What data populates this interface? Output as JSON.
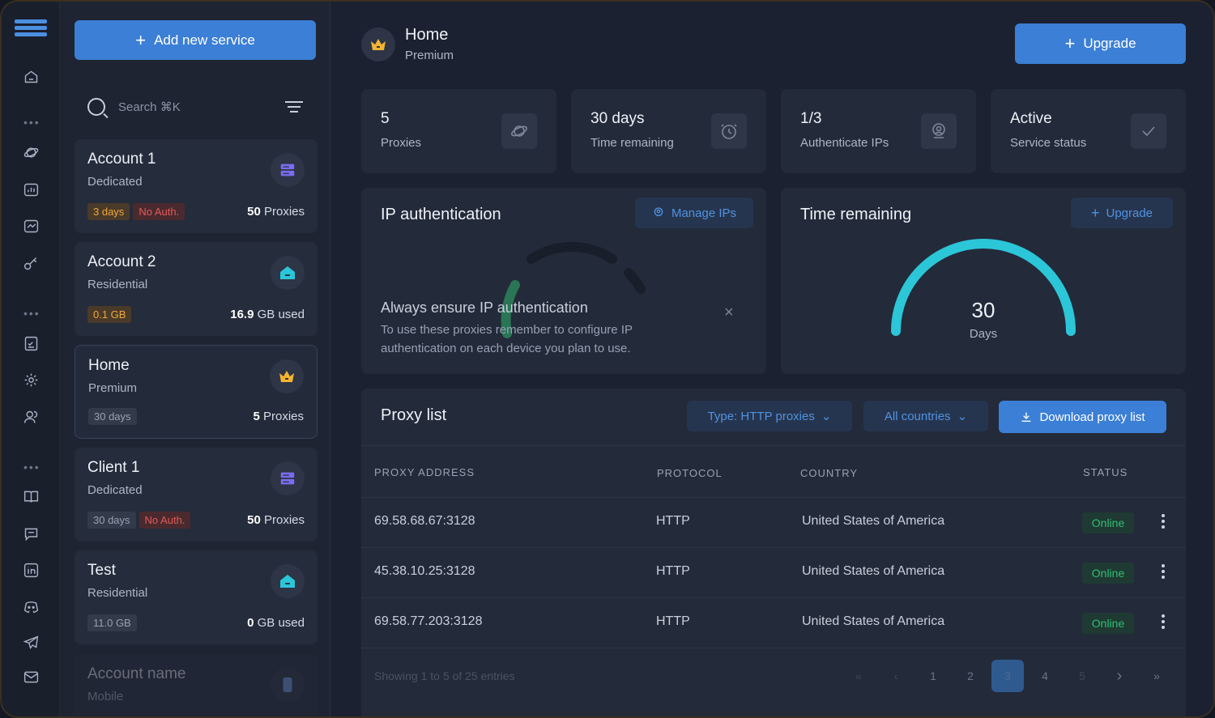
{
  "sidebar": {
    "logo": "server-logo",
    "icons": [
      "home-icon",
      "planet-icon",
      "chart-icon",
      "gauge-icon",
      "key-icon",
      "checklist-icon",
      "gear-icon",
      "users-icon",
      "book-icon",
      "chat-icon",
      "linkedin-icon",
      "discord-icon",
      "telegram-icon",
      "mail-icon"
    ],
    "dots": "•••"
  },
  "services": {
    "add_label": "Add new service",
    "search_placeholder": "Search ⌘K",
    "cards": [
      {
        "title": "Account 1",
        "subtitle": "Dedicated",
        "tags": [
          "3 days",
          "No Auth."
        ],
        "value": "50",
        "unit": " Proxies",
        "icon": "server-icon"
      },
      {
        "title": "Account 2",
        "subtitle": "Residential",
        "tags": [
          "0.1 GB"
        ],
        "value": "16.9",
        "unit": " GB used",
        "icon": "home-icon"
      },
      {
        "title": "Home",
        "subtitle": "Premium",
        "tags": [
          "30 days"
        ],
        "value": "5",
        "unit": " Proxies",
        "icon": "crown-icon"
      },
      {
        "title": "Client 1",
        "subtitle": "Dedicated",
        "tags": [
          "30 days",
          "No Auth."
        ],
        "value": "50",
        "unit": " Proxies",
        "icon": "server-icon"
      },
      {
        "title": "Test",
        "subtitle": "Residential",
        "tags": [
          "11.0 GB"
        ],
        "value": "0",
        "unit": " GB used",
        "icon": "home-icon"
      },
      {
        "title": "Account name",
        "subtitle": "Mobile",
        "icon": "mobile-icon"
      }
    ]
  },
  "header": {
    "title": "Home",
    "subtitle": "Premium",
    "upgrade_label": "Upgrade"
  },
  "stats": [
    {
      "value": "5",
      "label": "Proxies",
      "icon": "planet-icon"
    },
    {
      "value": "30 days",
      "label": "Time remaining",
      "icon": "clock-icon"
    },
    {
      "value": "1/3",
      "label": "Authenticate IPs",
      "icon": "user-pin-icon"
    },
    {
      "value": "Active",
      "label": "Service status",
      "icon": "check-icon"
    }
  ],
  "ip_auth": {
    "title": "IP authentication",
    "manage_label": "Manage IPs",
    "notice_title": "Always ensure IP authentication",
    "notice_text": "To use these proxies remember to configure IP authentication on each device you plan to use.",
    "close": "×"
  },
  "time_remaining": {
    "title": "Time remaining",
    "upgrade_label": "Upgrade",
    "value": "30",
    "unit": "Days",
    "fraction": 1.0,
    "color": "#2bc6d8"
  },
  "proxy_list": {
    "title": "Proxy list",
    "type_filter": "Type: HTTP proxies",
    "country_filter": "All countries",
    "download_label": "Download proxy list",
    "columns": [
      "PROXY ADDRESS",
      "PROTOCOL",
      "COUNTRY",
      "STATUS"
    ],
    "rows": [
      {
        "address": "69.58.68.67:3128",
        "protocol": "HTTP",
        "country": "United States of America",
        "status": "Online"
      },
      {
        "address": "45.38.10.25:3128",
        "protocol": "HTTP",
        "country": "United States of America",
        "status": "Online"
      },
      {
        "address": "69.58.77.203:3128",
        "protocol": "HTTP",
        "country": "United States of America",
        "status": "Online"
      }
    ],
    "footer": "Showing 1 to 5 of 25 entries",
    "pages": [
      "«",
      "‹",
      "1",
      "2",
      "3",
      "4",
      "5",
      "›",
      "»"
    ],
    "active_page": "3"
  }
}
